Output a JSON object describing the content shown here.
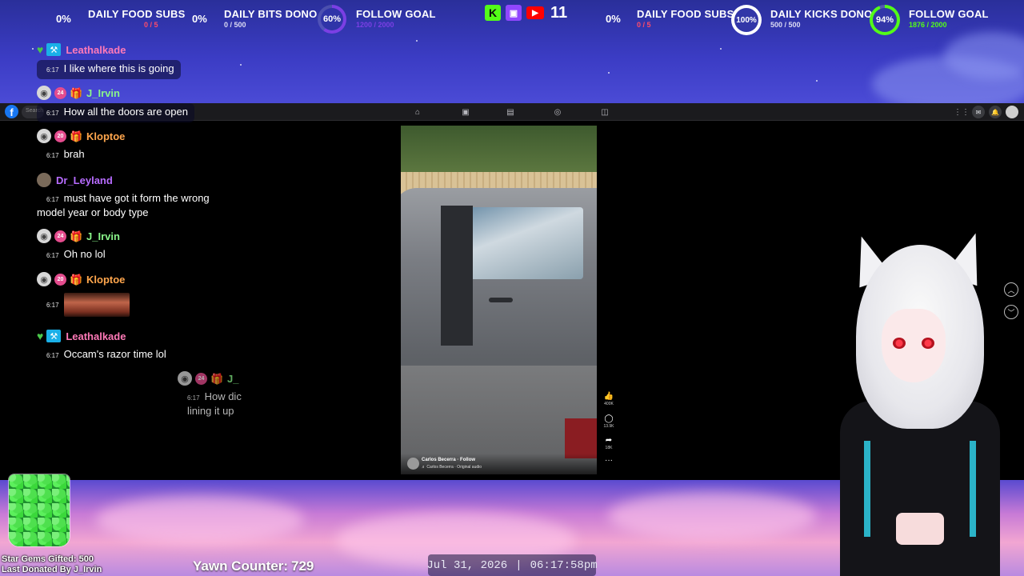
{
  "goals_left": [
    {
      "pct": "0%",
      "title": "DAILY FOOD SUBS",
      "sub": "0 / 5",
      "sub_color": "#ff4b6a"
    },
    {
      "pct": "0%",
      "title": "DAILY BITS DONO",
      "sub": "0 / 500",
      "sub_color": "#dcdcf4"
    }
  ],
  "follow_left": {
    "pct": "60%",
    "title": "FOLLOW GOAL",
    "sub": "1200 / 2000",
    "color": "#7b3fe4"
  },
  "platforms": {
    "icons": [
      "kick-icon",
      "twitch-icon",
      "youtube-icon"
    ],
    "viewer_count": "11"
  },
  "goals_right": [
    {
      "pct": "0%",
      "title": "DAILY FOOD SUBS",
      "sub": "0 / 5",
      "sub_color": "#ff4b6a"
    },
    {
      "pct": "100%",
      "title": "DAILY KICKS DONO",
      "sub": "500 / 500",
      "sub_color": "#dcdcf4"
    }
  ],
  "follow_right": {
    "pct": "94%",
    "title": "FOLLOW GOAL",
    "sub": "1876 / 2000",
    "color": "#53fc18"
  },
  "chat": [
    {
      "user": "Leathalkade",
      "color": "#ff7ab8",
      "time": "6:17",
      "text": "I like where this is going"
    },
    {
      "user": "J_Irvin",
      "color": "#8af58a",
      "badge": "24",
      "time": "6:17",
      "text": "How all the doors are open"
    },
    {
      "user": "Kloptoe",
      "color": "#ffa64d",
      "badge": "20",
      "time": "6:17",
      "text": "brah"
    },
    {
      "user": "Dr_Leyland",
      "color": "#b76cff",
      "time": "6:17",
      "text": "must have got it form the wrong model year or body type"
    },
    {
      "user": "J_Irvin",
      "color": "#8af58a",
      "badge": "24",
      "time": "6:17",
      "text": "Oh no lol"
    },
    {
      "user": "Kloptoe",
      "color": "#ffa64d",
      "badge": "20",
      "time": "6:17",
      "text": ""
    },
    {
      "user": "Leathalkade",
      "color": "#ff7ab8",
      "time": "6:17",
      "text": "Occam's razor time lol"
    },
    {
      "user": "J_",
      "color": "#8af58a",
      "badge": "24",
      "time": "6:17",
      "text": "How dic lining it up"
    }
  ],
  "video": {
    "author": "Carlos Becerra · Follow",
    "audio": "♬ Carlos Becerra · Original audio",
    "likes": "400K",
    "comments": "13.9K",
    "shares": "18K"
  },
  "browser": {
    "logo": "f",
    "search_placeholder": "Search"
  },
  "gems": {
    "gifted": "Star Gems Gifted: 500",
    "last_donor": "Last Donated By J_Irvin"
  },
  "yawn": {
    "label": "Yawn Counter:",
    "value": "729"
  },
  "clock": {
    "date": "Jul 31, 2026",
    "sep": "|",
    "time": "06:17:58pm"
  }
}
